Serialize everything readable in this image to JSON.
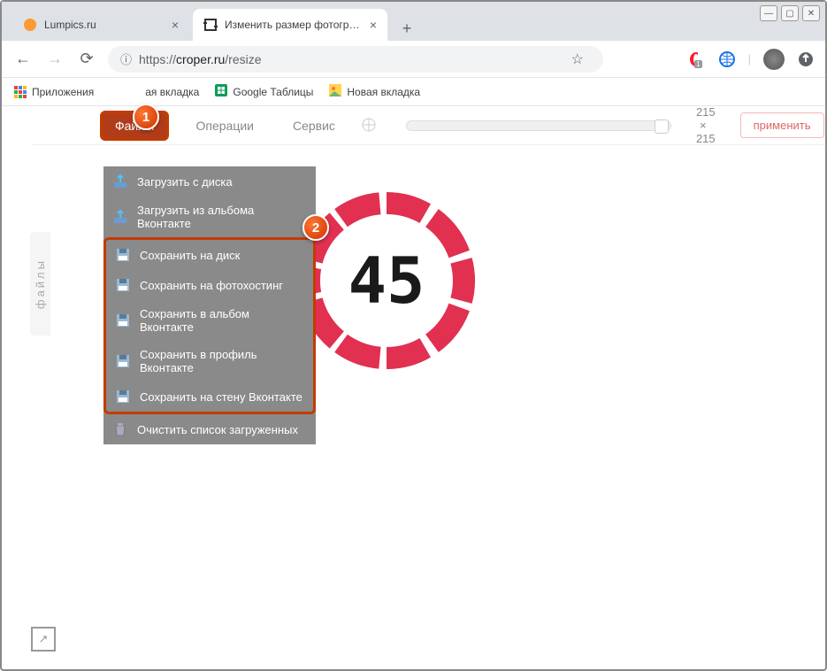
{
  "window_controls": {
    "minimize": "—",
    "maximize": "▢",
    "close": "✕"
  },
  "tabs": [
    {
      "title": "Lumpics.ru",
      "favicon_color": "#ff9933"
    },
    {
      "title": "Изменить размер фотографии",
      "favicon_color": "#333"
    }
  ],
  "new_tab": "+",
  "nav": {
    "back": "←",
    "forward": "→",
    "reload": "⟳"
  },
  "url": {
    "protocol": "https://",
    "domain": "croper.ru",
    "path": "/resize",
    "info_icon": "ⓘ",
    "star": "☆"
  },
  "bookmarks": {
    "apps": "Приложения",
    "new_tab_1": "ая вкладка",
    "google_sheets": "Google Таблицы",
    "new_tab_2": "Новая вкладка"
  },
  "toolbar": {
    "files": "Файлы",
    "operations": "Операции",
    "service": "Сервис",
    "width": "215",
    "sep": "×",
    "height": "215",
    "apply": "применить"
  },
  "dropdown": {
    "upload_disk": "Загрузить с диска",
    "upload_vk": "Загрузить из альбома Вконтакте",
    "save_disk": "Сохранить на диск",
    "save_hosting": "Сохранить на фотохостинг",
    "save_vk_album": "Сохранить в альбом Вконтакте",
    "save_vk_profile": "Сохранить в профиль Вконтакте",
    "save_vk_wall": "Сохранить на стену Вконтакте",
    "clear": "Очистить список загруженных"
  },
  "callouts": {
    "one": "1",
    "two": "2"
  },
  "side_tab": "файлы",
  "canvas_text": "45",
  "link_arrow": "↗"
}
